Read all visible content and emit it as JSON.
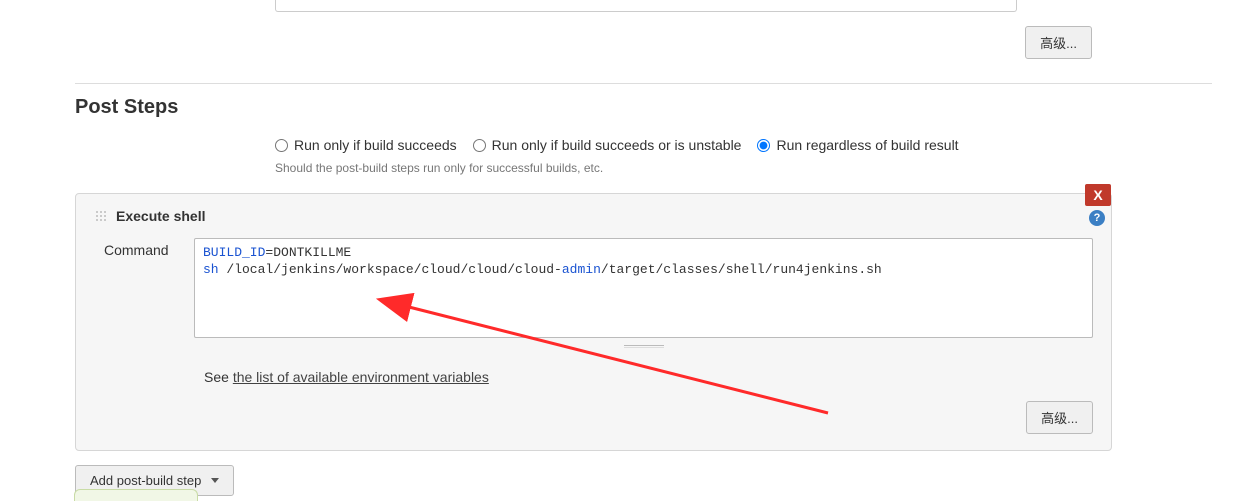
{
  "top_advanced_button": "高级...",
  "section_title": "Post Steps",
  "radios": {
    "opt1": "Run only if build succeeds",
    "opt2": "Run only if build succeeds or is unstable",
    "opt3": "Run regardless of build result",
    "selected": "opt3"
  },
  "radio_hint": "Should the post-build steps run only for successful builds, etc.",
  "step": {
    "title": "Execute shell",
    "close_label": "X",
    "command_label": "Command",
    "code_keyword": "BUILD_ID",
    "code_assign": "=DONTKILLME",
    "code_cmd": "sh ",
    "code_path_pre": "/local/jenkins/workspace/cloud/cloud/cloud-",
    "code_path_hl": "admin",
    "code_path_post": "/target/classes/shell/run4jenkins.sh",
    "env_prefix": "See ",
    "env_link": "the list of available environment variables",
    "inner_advanced": "高级...",
    "help_icon_label": "?"
  },
  "add_step_label": "Add post-build step"
}
